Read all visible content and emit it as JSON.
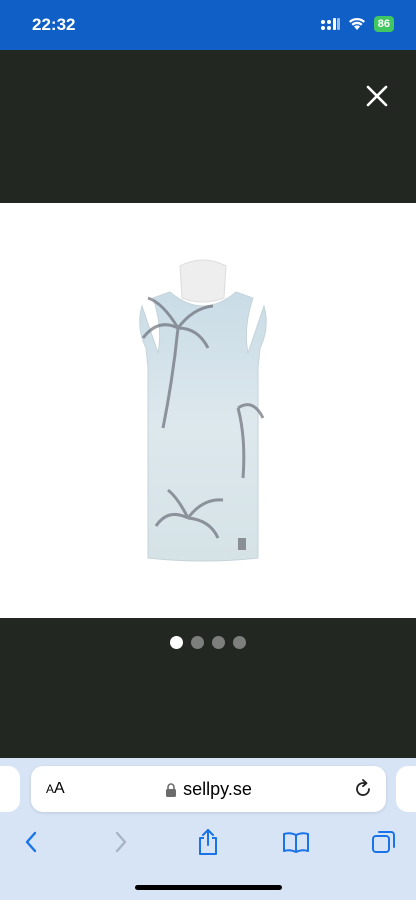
{
  "status_bar": {
    "time": "22:32",
    "battery": "86",
    "icons": [
      "signal-icon",
      "wifi-icon",
      "battery-icon"
    ]
  },
  "viewer": {
    "close_icon": "close-icon",
    "image_alt": "Sleeveless tank top with palm tree print",
    "pagination": {
      "total": 4,
      "current": 1
    }
  },
  "browser": {
    "text_size_label": "AA",
    "url": "sellpy.se",
    "icons": [
      "lock-icon",
      "reload-icon",
      "back-icon",
      "forward-icon",
      "share-icon",
      "bookmarks-icon",
      "tabs-icon"
    ]
  },
  "colors": {
    "status_bar": "#0f5fc6",
    "viewer_bg": "#222722",
    "browser_bar": "#d7e4f6",
    "accent_blue": "#1a73e8"
  }
}
